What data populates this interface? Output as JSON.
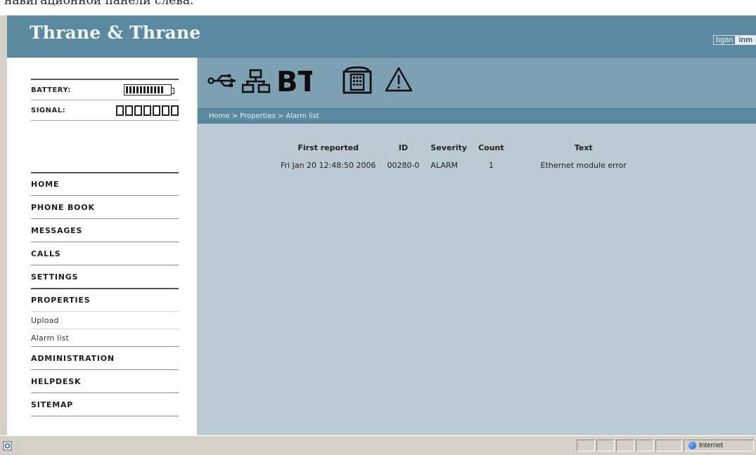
{
  "top_caption": "навигационной панели слева.",
  "header": {
    "brand": "Thrane & Thrane",
    "logo_left": "bgan",
    "logo_right": "inm"
  },
  "status": {
    "battery_label": "BATTERY:",
    "battery_level": 0.85,
    "signal_label": "SIGNAL:",
    "signal_bars": 7
  },
  "nav": {
    "items": [
      {
        "label": "HOME"
      },
      {
        "label": "PHONE BOOK"
      },
      {
        "label": "MESSAGES"
      },
      {
        "label": "CALLS"
      },
      {
        "label": "SETTINGS"
      },
      {
        "label": "PROPERTIES"
      },
      {
        "label": "Upload"
      },
      {
        "label": "Alarm list"
      },
      {
        "label": "ADMINISTRATION"
      },
      {
        "label": "HELPDESK"
      },
      {
        "label": "SITEMAP"
      }
    ]
  },
  "icons": [
    "usb-icon",
    "network-icon",
    "bluetooth-icon",
    "phone-icon",
    "warning-icon"
  ],
  "bt_text": "BT",
  "breadcrumb": "Home > Properties > Alarm list",
  "alarm_table": {
    "headers": [
      "First reported",
      "ID",
      "Severity",
      "Count",
      "Text"
    ],
    "rows": [
      {
        "date": "Fri Jan 20 12:48:50 2006",
        "id": "00280-0",
        "severity": "ALARM",
        "count": "1",
        "text": "Ethernet module error"
      }
    ]
  },
  "statusbar": {
    "zone": "Internet"
  }
}
